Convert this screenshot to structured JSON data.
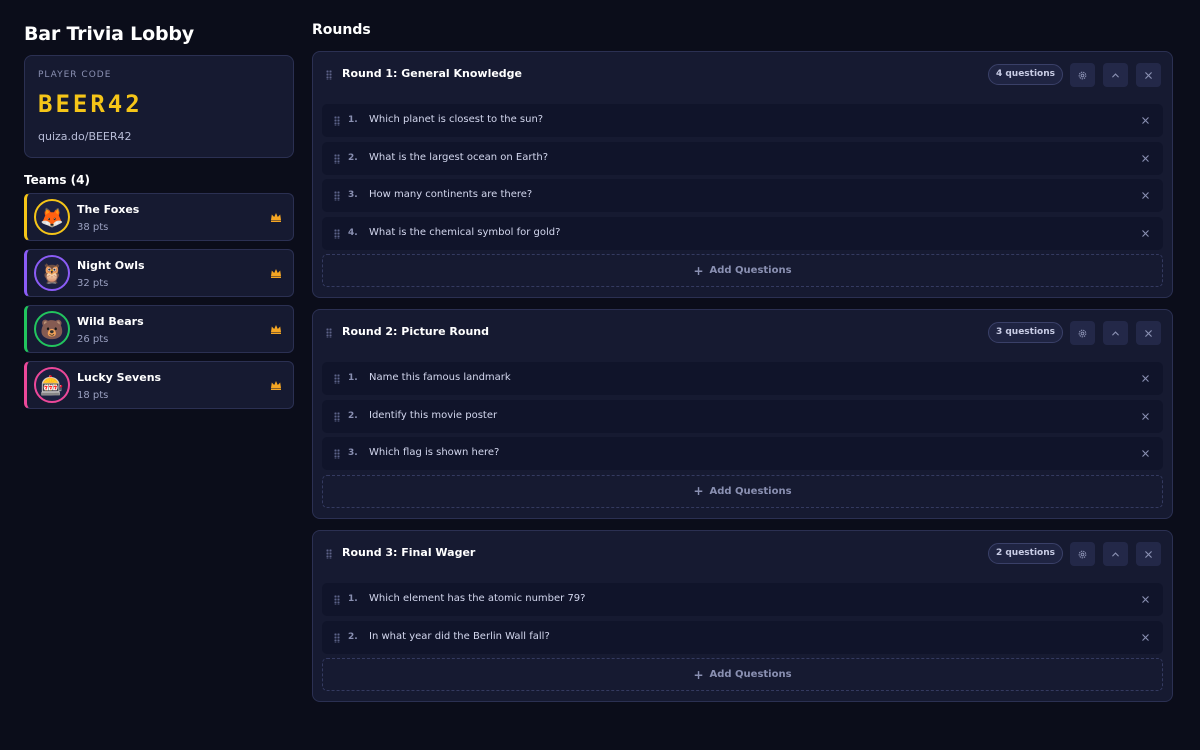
{
  "lobby": {
    "title": "Bar Trivia Lobby"
  },
  "player_code": {
    "label": "PLAYER CODE",
    "code": "BEER42",
    "link": "quiza.do/BEER42"
  },
  "teams": {
    "heading": "Teams (4)",
    "items": [
      {
        "name": "The Foxes",
        "points": "38 pts",
        "avatar": "🦊",
        "color": "#f5c518",
        "avatar_icon": "fox-icon"
      },
      {
        "name": "Night Owls",
        "points": "32 pts",
        "avatar": "🦉",
        "color": "#8b5cf6",
        "avatar_icon": "owl-icon"
      },
      {
        "name": "Wild Bears",
        "points": "26 pts",
        "avatar": "🐻",
        "color": "#22c55e",
        "avatar_icon": "bear-icon"
      },
      {
        "name": "Lucky Sevens",
        "points": "18 pts",
        "avatar": "🎰",
        "color": "#ec4899",
        "avatar_icon": "slot-machine-icon"
      }
    ]
  },
  "rounds": {
    "heading": "Rounds",
    "add_label": "Add Questions",
    "items": [
      {
        "title": "Round 1: General Knowledge",
        "count": "4 questions",
        "questions": [
          {
            "num": "1.",
            "text": "Which planet is closest to the sun?"
          },
          {
            "num": "2.",
            "text": "What is the largest ocean on Earth?"
          },
          {
            "num": "3.",
            "text": "How many continents are there?"
          },
          {
            "num": "4.",
            "text": "What is the chemical symbol for gold?"
          }
        ]
      },
      {
        "title": "Round 2: Picture Round",
        "count": "3 questions",
        "questions": [
          {
            "num": "1.",
            "text": "Name this famous landmark"
          },
          {
            "num": "2.",
            "text": "Identify this movie poster"
          },
          {
            "num": "3.",
            "text": "Which flag is shown here?"
          }
        ]
      },
      {
        "title": "Round 3: Final Wager",
        "count": "2 questions",
        "questions": [
          {
            "num": "1.",
            "text": "Which element has the atomic number 79?"
          },
          {
            "num": "2.",
            "text": "In what year did the Berlin Wall fall?"
          }
        ]
      }
    ]
  },
  "colors": {
    "accent": "#f5c518",
    "background": "#0b0d1a",
    "card": "#161a31"
  }
}
